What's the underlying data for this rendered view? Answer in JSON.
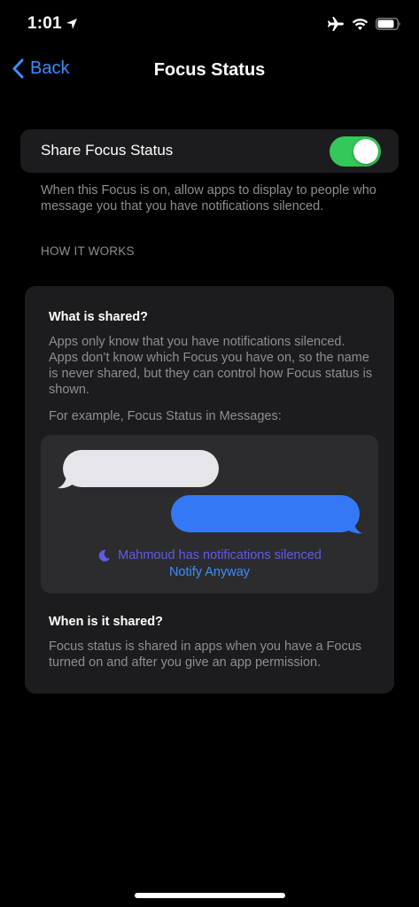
{
  "status_bar": {
    "time": "1:01",
    "icons": [
      "location-arrow-icon",
      "airplane-icon",
      "wifi-icon",
      "battery-icon"
    ]
  },
  "nav": {
    "back_label": "Back",
    "title": "Focus Status"
  },
  "toggle": {
    "label": "Share Focus Status",
    "state": "on"
  },
  "footer_note": "When this Focus is on, allow apps to display to people who message you that you have notifications silenced.",
  "section_header": "HOW IT WORKS",
  "card": {
    "heading_1": "What is shared?",
    "body_1": "Apps only know that you have notifications silenced. Apps don’t know which Focus you have on, so the name is never shared, but they can control how Focus status is shown.",
    "body_2": "For example, Focus Status in Messages:",
    "example": {
      "silenced_text": "Mahmoud has notifications silenced",
      "notify_label": "Notify Anyway"
    },
    "heading_2": "When is it shared?",
    "body_3": "Focus status is shared in apps when you have a Focus turned on and after you give an app permission."
  },
  "colors": {
    "accent_blue": "#3d8eff",
    "toggle_green": "#34c759",
    "focus_purple": "#5e5ce6",
    "received_bubble": "#e5e5ea",
    "sent_bubble": "#3478f6"
  }
}
